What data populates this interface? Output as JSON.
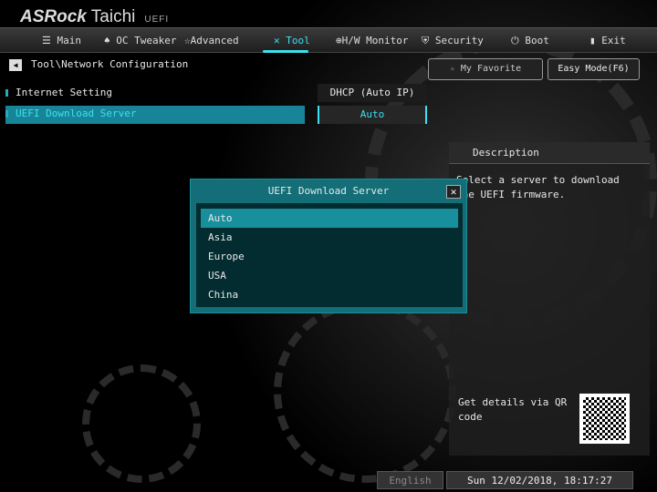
{
  "brand": {
    "name": "ASRock",
    "model": "Taichi",
    "suffix": "UEFI"
  },
  "nav": [
    {
      "label": "Main",
      "icon": "list-icon"
    },
    {
      "label": "OC Tweaker",
      "icon": "rocket-icon"
    },
    {
      "label": "Advanced",
      "icon": "star-icon"
    },
    {
      "label": "Tool",
      "icon": "tools-icon",
      "active": true
    },
    {
      "label": "H/W Monitor",
      "icon": "monitor-icon"
    },
    {
      "label": "Security",
      "icon": "shield-icon"
    },
    {
      "label": "Boot",
      "icon": "power-icon"
    },
    {
      "label": "Exit",
      "icon": "exit-icon"
    }
  ],
  "breadcrumb": "Tool\\Network Configuration",
  "buttons": {
    "favorite": "My Favorite",
    "easy_mode": "Easy Mode(F6)"
  },
  "settings": [
    {
      "label": "Internet Setting",
      "value": "DHCP (Auto IP)"
    },
    {
      "label": "UEFI Download Server",
      "value": "Auto"
    }
  ],
  "description": {
    "title": "Description",
    "text": "Select a server to download the UEFI firmware.",
    "qr_text": "Get details via QR code"
  },
  "popup": {
    "title": "UEFI Download Server",
    "options": [
      "Auto",
      "Asia",
      "Europe",
      "USA",
      "China"
    ],
    "selected": "Auto"
  },
  "status": {
    "language": "English",
    "datetime": "Sun 12/02/2018, 18:17:27"
  },
  "colors": {
    "accent": "#3ee0f0",
    "highlight": "#178597"
  }
}
